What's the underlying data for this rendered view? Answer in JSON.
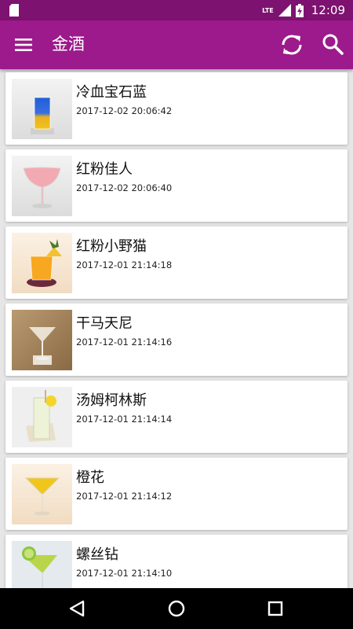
{
  "status_bar": {
    "network": "LTE",
    "time": "12:09"
  },
  "app_bar": {
    "title": "金酒",
    "color": "#9c1a8b",
    "icons": [
      "menu-icon",
      "refresh-icon",
      "search-icon"
    ]
  },
  "items": [
    {
      "name": "冷血宝石蓝",
      "time": "2017-12-02 20:06:42"
    },
    {
      "name": "红粉佳人",
      "time": "2017-12-02 20:06:40"
    },
    {
      "name": "红粉小野猫",
      "time": "2017-12-01 21:14:18"
    },
    {
      "name": "干马天尼",
      "time": "2017-12-01 21:14:16"
    },
    {
      "name": "汤姆柯林斯",
      "time": "2017-12-01 21:14:14"
    },
    {
      "name": "橙花",
      "time": "2017-12-01 21:14:12"
    },
    {
      "name": "螺丝钻",
      "time": "2017-12-01 21:14:10"
    }
  ],
  "nav_bar": {
    "icons": [
      "back-icon",
      "home-icon",
      "recents-icon"
    ]
  }
}
